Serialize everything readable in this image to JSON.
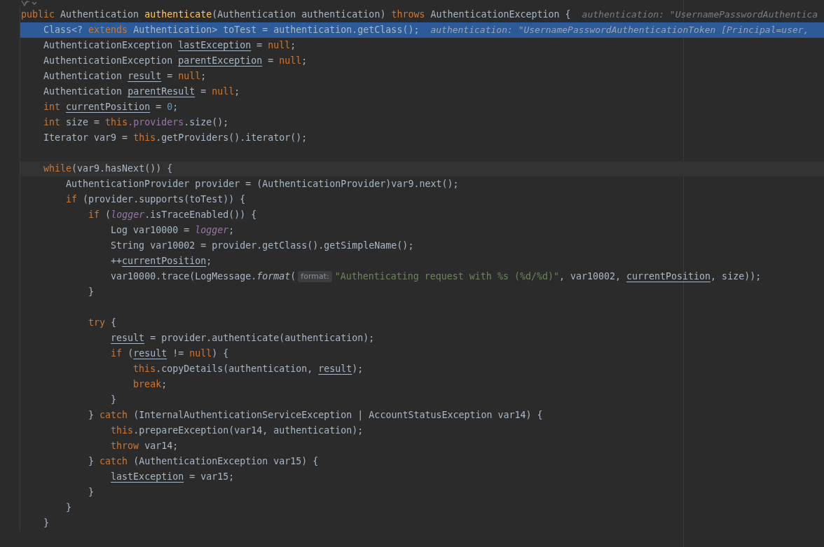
{
  "editor": {
    "lines": [
      {
        "kind": "normal",
        "segments": [
          {
            "kind": "code",
            "tokens": [
              {
                "t": "public ",
                "kind": "keyword"
              },
              {
                "t": "Authentication ",
                "kind": "plain"
              },
              {
                "t": "authenticate",
                "kind": "method-declaration"
              },
              {
                "t": "(Authentication authentication) ",
                "kind": "plain"
              },
              {
                "t": "throws ",
                "kind": "keyword"
              },
              {
                "t": "AuthenticationException {",
                "kind": "plain"
              }
            ]
          },
          {
            "kind": "value-hint",
            "text": "authentication: \"UsernamePasswordAuthentica"
          }
        ]
      },
      {
        "kind": "execution",
        "segments": [
          {
            "kind": "code",
            "tokens": [
              {
                "t": "    Class<? ",
                "kind": "plain"
              },
              {
                "t": "extends ",
                "kind": "keyword"
              },
              {
                "t": "Authentication> toTest = authentication.getClass();",
                "kind": "plain"
              }
            ]
          },
          {
            "kind": "value-hint",
            "text": "authentication: \"UsernamePasswordAuthenticationToken [Principal=user,"
          }
        ]
      },
      {
        "kind": "normal",
        "segments": [
          {
            "kind": "code",
            "tokens": [
              {
                "t": "    AuthenticationException ",
                "kind": "plain"
              },
              {
                "t": "lastException",
                "kind": "reassigned"
              },
              {
                "t": " = ",
                "kind": "plain"
              },
              {
                "t": "null",
                "kind": "keyword"
              },
              {
                "t": ";",
                "kind": "plain"
              }
            ]
          }
        ]
      },
      {
        "kind": "normal",
        "segments": [
          {
            "kind": "code",
            "tokens": [
              {
                "t": "    AuthenticationException ",
                "kind": "plain"
              },
              {
                "t": "parentException",
                "kind": "reassigned"
              },
              {
                "t": " = ",
                "kind": "plain"
              },
              {
                "t": "null",
                "kind": "keyword"
              },
              {
                "t": ";",
                "kind": "plain"
              }
            ]
          }
        ]
      },
      {
        "kind": "normal",
        "segments": [
          {
            "kind": "code",
            "tokens": [
              {
                "t": "    Authentication ",
                "kind": "plain"
              },
              {
                "t": "result",
                "kind": "reassigned"
              },
              {
                "t": " = ",
                "kind": "plain"
              },
              {
                "t": "null",
                "kind": "keyword"
              },
              {
                "t": ";",
                "kind": "plain"
              }
            ]
          }
        ]
      },
      {
        "kind": "normal",
        "segments": [
          {
            "kind": "code",
            "tokens": [
              {
                "t": "    Authentication ",
                "kind": "plain"
              },
              {
                "t": "parentResult",
                "kind": "reassigned"
              },
              {
                "t": " = ",
                "kind": "plain"
              },
              {
                "t": "null",
                "kind": "keyword"
              },
              {
                "t": ";",
                "kind": "plain"
              }
            ]
          }
        ]
      },
      {
        "kind": "normal",
        "segments": [
          {
            "kind": "code",
            "tokens": [
              {
                "t": "    int ",
                "kind": "keyword"
              },
              {
                "t": "currentPosition",
                "kind": "reassigned"
              },
              {
                "t": " = ",
                "kind": "plain"
              },
              {
                "t": "0",
                "kind": "number"
              },
              {
                "t": ";",
                "kind": "plain"
              }
            ]
          }
        ]
      },
      {
        "kind": "normal",
        "segments": [
          {
            "kind": "code",
            "tokens": [
              {
                "t": "    int ",
                "kind": "keyword"
              },
              {
                "t": "size = ",
                "kind": "plain"
              },
              {
                "t": "this",
                "kind": "keyword"
              },
              {
                "t": ".providers",
                "kind": "field"
              },
              {
                "t": ".size();",
                "kind": "plain"
              }
            ]
          }
        ]
      },
      {
        "kind": "normal",
        "segments": [
          {
            "kind": "code",
            "tokens": [
              {
                "t": "    Iterator var9 = ",
                "kind": "plain"
              },
              {
                "t": "this",
                "kind": "keyword"
              },
              {
                "t": ".getProviders().iterator();",
                "kind": "plain"
              }
            ]
          }
        ]
      },
      {
        "kind": "normal"
      },
      {
        "kind": "caret",
        "segments": [
          {
            "kind": "code",
            "tokens": [
              {
                "t": "    while",
                "kind": "keyword"
              },
              {
                "t": "(var9.hasNext()) {",
                "kind": "plain"
              }
            ]
          }
        ]
      },
      {
        "kind": "normal",
        "segments": [
          {
            "kind": "code",
            "tokens": [
              {
                "t": "        AuthenticationProvider provider = (AuthenticationProvider)var9.next();",
                "kind": "plain"
              }
            ]
          }
        ]
      },
      {
        "kind": "normal",
        "segments": [
          {
            "kind": "code",
            "tokens": [
              {
                "t": "        if ",
                "kind": "keyword"
              },
              {
                "t": "(provider.supports(toTest)) {",
                "kind": "plain"
              }
            ]
          }
        ]
      },
      {
        "kind": "normal",
        "segments": [
          {
            "kind": "code",
            "tokens": [
              {
                "t": "            if ",
                "kind": "keyword"
              },
              {
                "t": "(",
                "kind": "plain"
              },
              {
                "t": "logger",
                "kind": "static-field"
              },
              {
                "t": ".isTraceEnabled()) {",
                "kind": "plain"
              }
            ]
          }
        ]
      },
      {
        "kind": "normal",
        "segments": [
          {
            "kind": "code",
            "tokens": [
              {
                "t": "                Log var10000 = ",
                "kind": "plain"
              },
              {
                "t": "logger",
                "kind": "static-field"
              },
              {
                "t": ";",
                "kind": "plain"
              }
            ]
          }
        ]
      },
      {
        "kind": "normal",
        "segments": [
          {
            "kind": "code",
            "tokens": [
              {
                "t": "                String var10002 = provider.getClass().getSimpleName();",
                "kind": "plain"
              }
            ]
          }
        ]
      },
      {
        "kind": "normal",
        "segments": [
          {
            "kind": "code",
            "tokens": [
              {
                "t": "                ++",
                "kind": "plain"
              },
              {
                "t": "currentPosition",
                "kind": "reassigned"
              },
              {
                "t": ";",
                "kind": "plain"
              }
            ]
          }
        ]
      },
      {
        "kind": "normal",
        "segments": [
          {
            "kind": "code",
            "tokens": [
              {
                "t": "                var10000.trace(LogMessage.",
                "kind": "plain"
              },
              {
                "t": "format",
                "kind": "static-method"
              },
              {
                "t": "(",
                "kind": "plain"
              }
            ]
          },
          {
            "kind": "param-hint",
            "text": "format:"
          },
          {
            "kind": "code",
            "tokens": [
              {
                "t": "\"Authenticating request with %s (%d/%d)\"",
                "kind": "string"
              },
              {
                "t": ", var10002, ",
                "kind": "plain"
              },
              {
                "t": "currentPosition",
                "kind": "reassigned"
              },
              {
                "t": ", size));",
                "kind": "plain"
              }
            ]
          }
        ]
      },
      {
        "kind": "normal",
        "segments": [
          {
            "kind": "code",
            "tokens": [
              {
                "t": "            }",
                "kind": "plain"
              }
            ]
          }
        ]
      },
      {
        "kind": "normal"
      },
      {
        "kind": "normal",
        "segments": [
          {
            "kind": "code",
            "tokens": [
              {
                "t": "            try ",
                "kind": "keyword"
              },
              {
                "t": "{",
                "kind": "plain"
              }
            ]
          }
        ]
      },
      {
        "kind": "normal",
        "segments": [
          {
            "kind": "code",
            "tokens": [
              {
                "t": "                result",
                "kind": "reassigned"
              },
              {
                "t": " = provider.authenticate(authentication);",
                "kind": "plain"
              }
            ]
          }
        ]
      },
      {
        "kind": "normal",
        "segments": [
          {
            "kind": "code",
            "tokens": [
              {
                "t": "                if ",
                "kind": "keyword"
              },
              {
                "t": "(",
                "kind": "plain"
              },
              {
                "t": "result",
                "kind": "reassigned"
              },
              {
                "t": " != ",
                "kind": "plain"
              },
              {
                "t": "null",
                "kind": "keyword"
              },
              {
                "t": ") {",
                "kind": "plain"
              }
            ]
          }
        ]
      },
      {
        "kind": "normal",
        "segments": [
          {
            "kind": "code",
            "tokens": [
              {
                "t": "                    this",
                "kind": "keyword"
              },
              {
                "t": ".copyDetails(authentication, ",
                "kind": "plain"
              },
              {
                "t": "result",
                "kind": "reassigned"
              },
              {
                "t": ");",
                "kind": "plain"
              }
            ]
          }
        ]
      },
      {
        "kind": "normal",
        "segments": [
          {
            "kind": "code",
            "tokens": [
              {
                "t": "                    break",
                "kind": "keyword"
              },
              {
                "t": ";",
                "kind": "plain"
              }
            ]
          }
        ]
      },
      {
        "kind": "normal",
        "segments": [
          {
            "kind": "code",
            "tokens": [
              {
                "t": "                }",
                "kind": "plain"
              }
            ]
          }
        ]
      },
      {
        "kind": "normal",
        "segments": [
          {
            "kind": "code",
            "tokens": [
              {
                "t": "            } ",
                "kind": "plain"
              },
              {
                "t": "catch ",
                "kind": "keyword"
              },
              {
                "t": "(InternalAuthenticationServiceException | AccountStatusException var14) {",
                "kind": "plain"
              }
            ]
          }
        ]
      },
      {
        "kind": "normal",
        "segments": [
          {
            "kind": "code",
            "tokens": [
              {
                "t": "                this",
                "kind": "keyword"
              },
              {
                "t": ".prepareException(var14, authentication);",
                "kind": "plain"
              }
            ]
          }
        ]
      },
      {
        "kind": "normal",
        "segments": [
          {
            "kind": "code",
            "tokens": [
              {
                "t": "                throw ",
                "kind": "keyword"
              },
              {
                "t": "var14;",
                "kind": "plain"
              }
            ]
          }
        ]
      },
      {
        "kind": "normal",
        "segments": [
          {
            "kind": "code",
            "tokens": [
              {
                "t": "            } ",
                "kind": "plain"
              },
              {
                "t": "catch ",
                "kind": "keyword"
              },
              {
                "t": "(AuthenticationException var15) {",
                "kind": "plain"
              }
            ]
          }
        ]
      },
      {
        "kind": "normal",
        "segments": [
          {
            "kind": "code",
            "tokens": [
              {
                "t": "                lastException",
                "kind": "reassigned"
              },
              {
                "t": " = var15;",
                "kind": "plain"
              }
            ]
          }
        ]
      },
      {
        "kind": "normal",
        "segments": [
          {
            "kind": "code",
            "tokens": [
              {
                "t": "            }",
                "kind": "plain"
              }
            ]
          }
        ]
      },
      {
        "kind": "normal",
        "segments": [
          {
            "kind": "code",
            "tokens": [
              {
                "t": "        }",
                "kind": "plain"
              }
            ]
          }
        ]
      },
      {
        "kind": "normal",
        "segments": [
          {
            "kind": "code",
            "tokens": [
              {
                "t": "    }",
                "kind": "plain"
              }
            ]
          }
        ]
      }
    ]
  }
}
